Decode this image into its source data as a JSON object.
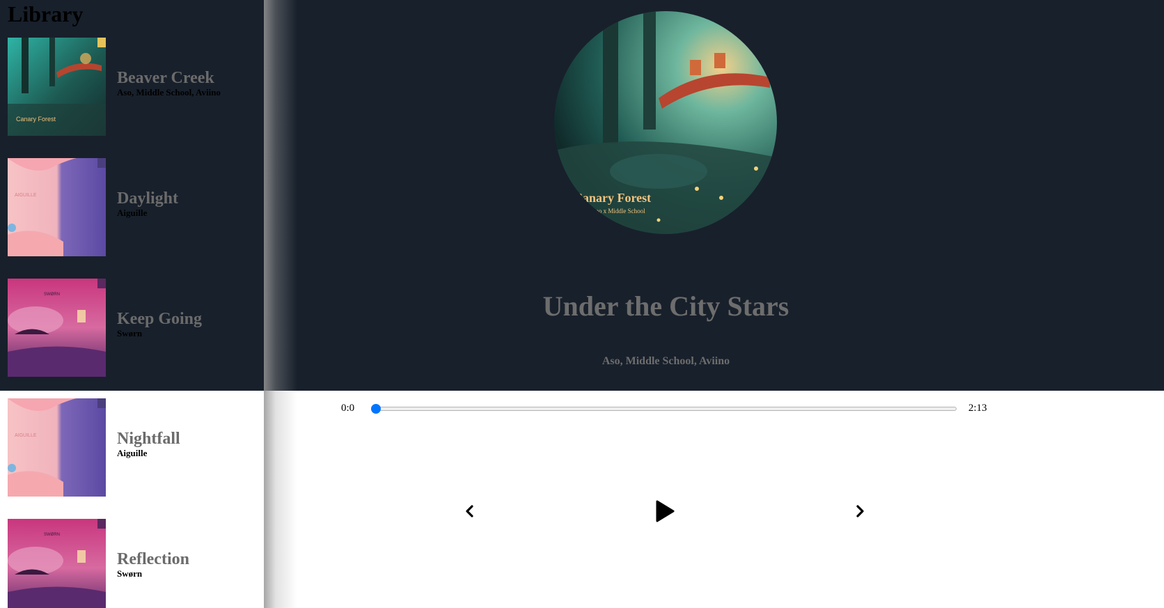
{
  "library": {
    "title": "Library",
    "tracks": [
      {
        "title": "Beaver Creek",
        "artist": "Aso, Middle School, Aviino",
        "cover": "canary-forest",
        "cover_text": "Canary Forest"
      },
      {
        "title": "Daylight",
        "artist": "Aiguille",
        "cover": "day-and-night",
        "cover_text": "AIGUILLE"
      },
      {
        "title": "Keep Going",
        "artist": "Swørn",
        "cover": "sworn-pink",
        "cover_text": "SWØRN"
      },
      {
        "title": "Nightfall",
        "artist": "Aiguille",
        "cover": "day-and-night",
        "cover_text": "AIGUILLE"
      },
      {
        "title": "Reflection",
        "artist": "Swørn",
        "cover": "sworn-pink",
        "cover_text": "SWØRN"
      }
    ]
  },
  "player": {
    "title": "Under the City Stars",
    "artist": "Aso, Middle School, Aviino",
    "cover": "canary-forest",
    "cover_text": "Canary Forest",
    "cover_subtext": "Aviino x Middle School",
    "time_current": "0:0",
    "time_total": "2:13",
    "progress": 0.0
  },
  "controls": {
    "prev_icon": "chevron-left-icon",
    "play_icon": "play-icon",
    "next_icon": "chevron-right-icon"
  },
  "colors": {
    "dark_bg": "#18202b",
    "accent": "#0075ff",
    "title_gray": "#6d6d6d"
  }
}
